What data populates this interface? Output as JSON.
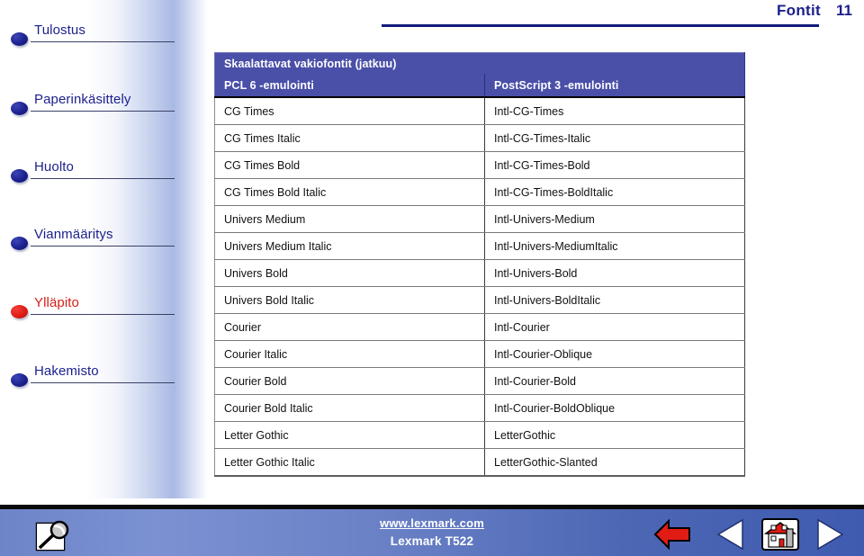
{
  "header": {
    "title": "Fontit",
    "page_number": "11"
  },
  "sidebar": {
    "items": [
      {
        "label": "Tulostus",
        "bullet": "blue-bullet-icon",
        "active": false
      },
      {
        "label": "Paperinkäsittely",
        "bullet": "blue-bullet-icon",
        "active": false
      },
      {
        "label": "Huolto",
        "bullet": "blue-bullet-icon",
        "active": false
      },
      {
        "label": "Vianmääritys",
        "bullet": "blue-bullet-icon",
        "active": false
      },
      {
        "label": "Ylläpito",
        "bullet": "red-bullet-icon",
        "active": true
      },
      {
        "label": "Hakemisto",
        "bullet": "blue-bullet-icon",
        "active": false
      }
    ]
  },
  "table": {
    "title": "Skaalattavat vakiofontit (jatkuu)",
    "columns": [
      "PCL 6 -emulointi",
      "PostScript 3 -emulointi"
    ],
    "rows": [
      [
        "CG Times",
        "Intl-CG-Times"
      ],
      [
        "CG Times Italic",
        "Intl-CG-Times-Italic"
      ],
      [
        "CG Times Bold",
        "Intl-CG-Times-Bold"
      ],
      [
        "CG Times Bold Italic",
        "Intl-CG-Times-BoldItalic"
      ],
      [
        "Univers Medium",
        "Intl-Univers-Medium"
      ],
      [
        "Univers Medium Italic",
        "Intl-Univers-MediumItalic"
      ],
      [
        "Univers Bold",
        "Intl-Univers-Bold"
      ],
      [
        "Univers Bold Italic",
        "Intl-Univers-BoldItalic"
      ],
      [
        "Courier",
        "Intl-Courier"
      ],
      [
        "Courier Italic",
        "Intl-Courier-Oblique"
      ],
      [
        "Courier Bold",
        "Intl-Courier-Bold"
      ],
      [
        "Courier Bold Italic",
        "Intl-Courier-BoldOblique"
      ],
      [
        "Letter Gothic",
        "LetterGothic"
      ],
      [
        "Letter Gothic Italic",
        "LetterGothic-Slanted"
      ]
    ]
  },
  "footer": {
    "url": "www.lexmark.com",
    "model": "Lexmark T522",
    "search_icon": "magnifier-icon",
    "buttons": [
      {
        "name": "back-arrow-icon",
        "glyph": "red-left-arrow"
      },
      {
        "name": "previous-page-icon",
        "glyph": "white-left-triangle"
      },
      {
        "name": "home-icon",
        "glyph": "house"
      },
      {
        "name": "next-page-icon",
        "glyph": "white-right-triangle"
      }
    ]
  },
  "colors": {
    "brand_blue": "#1b1f8c",
    "table_header": "#4a4fa8",
    "accent_red": "#d4201a",
    "footer_blue": "#5b74bd",
    "rule_blue": "#131a7a"
  }
}
